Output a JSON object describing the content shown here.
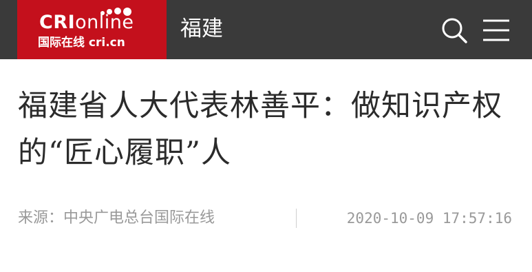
{
  "header": {
    "logo": {
      "brand_prefix": "CRI",
      "brand_suffix": "online",
      "tagline": "国际在线 cri.cn"
    },
    "channel_label": "福建",
    "search_icon": "search-icon",
    "menu_icon": "menu-icon"
  },
  "article": {
    "title": "福建省人大代表林善平：做知识产权的“匠心履职”人",
    "source": "来源：中央广电总台国际在线",
    "published": "2020-10-09 17:57:16"
  },
  "colors": {
    "header_bg": "#3a3a3a",
    "brand_red": "#c4101c",
    "title_text": "#2b2b2b",
    "meta_text": "#999999"
  }
}
